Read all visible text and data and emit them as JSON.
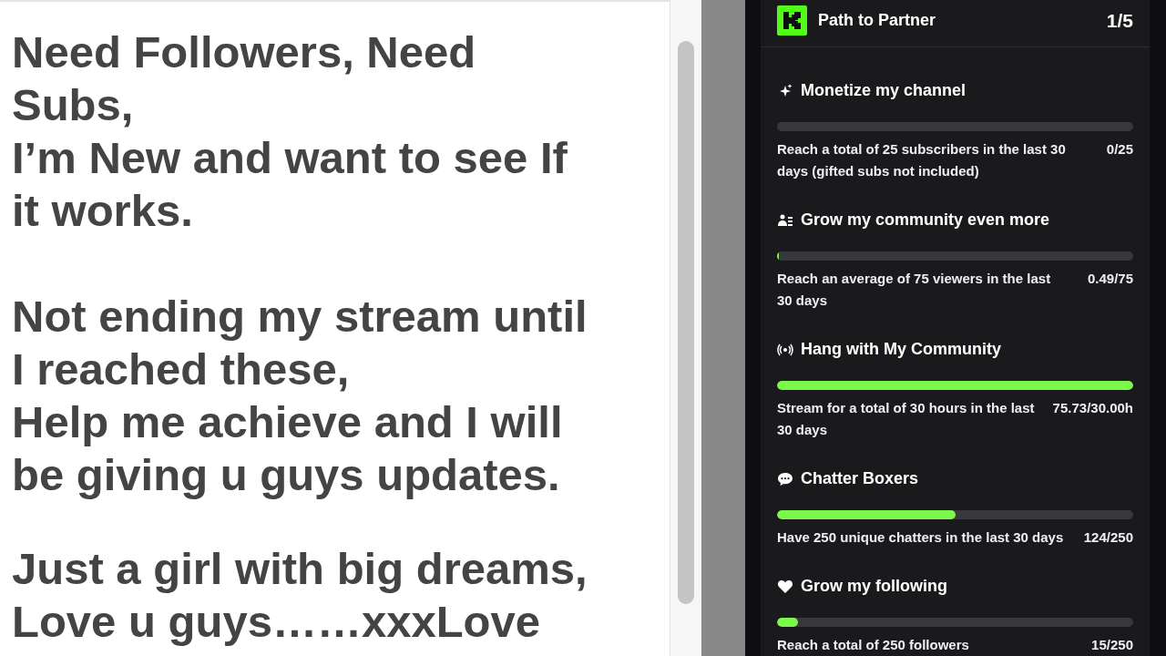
{
  "document": {
    "paragraphs": [
      {
        "lines": [
          "Need Followers, Need",
          "Subs,",
          "I’m New and want to see If",
          "it works."
        ]
      },
      {
        "lines": [
          "Not ending my stream until",
          "I reached these,",
          "Help me achieve and I will",
          "be giving u guys updates."
        ]
      },
      {
        "lines": [
          "Just a girl with big dreams,",
          "Love u guys……xxxLove"
        ]
      }
    ]
  },
  "panel": {
    "title": "Path to Partner",
    "page": "1/5",
    "goals": [
      {
        "kind": "sparkle",
        "title": "Monetize my channel",
        "level": 0,
        "description": "Reach a total of 25 subscribers in the last 30 days (gifted subs not included)",
        "progress": "0/25"
      },
      {
        "kind": "people",
        "title": "Grow my community even more",
        "level": 0.006,
        "description": "Reach an average of 75 viewers in the last 30 days",
        "progress": "0.49/75"
      },
      {
        "kind": "broadcast",
        "title": "Hang with My Community",
        "level": 1,
        "description": "Stream for a total of 30 hours in the last 30 days",
        "progress": "75.73/30.00h"
      },
      {
        "kind": "chat",
        "title": "Chatter Boxers",
        "level": 0.5,
        "description": "Have 250 unique chatters in the last 30 days",
        "progress": "124/250"
      },
      {
        "kind": "heart",
        "title": "Grow my following",
        "level": 0.06,
        "description": "Reach a total of 250 followers",
        "progress": "15/250"
      }
    ]
  }
}
